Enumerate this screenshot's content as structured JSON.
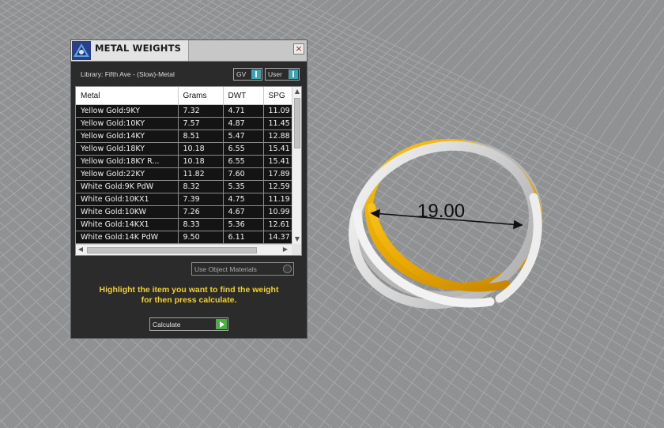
{
  "window": {
    "title": "METAL WEIGHTS",
    "close_label": "×"
  },
  "library": {
    "label": "Library: Fifth Ave - (Slow)-Metal",
    "toggle_gv": "GV",
    "toggle_user": "User"
  },
  "table": {
    "columns": [
      "Metal",
      "Grams",
      "DWT",
      "SPG"
    ],
    "rows": [
      [
        "Yellow Gold:9KY",
        "7.32",
        "4.71",
        "11.09"
      ],
      [
        "Yellow Gold:10KY",
        "7.57",
        "4.87",
        "11.45"
      ],
      [
        "Yellow Gold:14KY",
        "8.51",
        "5.47",
        "12.88"
      ],
      [
        "Yellow Gold:18KY",
        "10.18",
        "6.55",
        "15.41"
      ],
      [
        "Yellow Gold:18KY R...",
        "10.18",
        "6.55",
        "15.41"
      ],
      [
        "Yellow Gold:22KY",
        "11.82",
        "7.60",
        "17.89"
      ],
      [
        "White Gold:9K PdW",
        "8.32",
        "5.35",
        "12.59"
      ],
      [
        "White Gold:10KX1",
        "7.39",
        "4.75",
        "11.19"
      ],
      [
        "White Gold:10KW",
        "7.26",
        "4.67",
        "10.99"
      ],
      [
        "White Gold:14KX1",
        "8.33",
        "5.36",
        "12.61"
      ],
      [
        "White Gold:14K PdW",
        "9.50",
        "6.11",
        "14.37"
      ]
    ]
  },
  "options": {
    "use_object_materials": "Use Object Materials"
  },
  "hint": {
    "line1": "Highlight the item you want to find the weight",
    "line2": "for then press calculate."
  },
  "calculate": {
    "label": "Calculate"
  },
  "viewport": {
    "dimension": "19.00"
  },
  "colors": {
    "panel_bg": "#2b2b2b",
    "hint_yellow": "#f2cf2a",
    "toggle_teal": "#3fa2b0",
    "calc_green": "#45b43f",
    "gold": "#e6a500",
    "silver": "#d9d9d9"
  },
  "icons": {
    "app_logo": "matrix-logo-icon",
    "close": "close-icon",
    "calculate": "play-arrow-icon"
  }
}
